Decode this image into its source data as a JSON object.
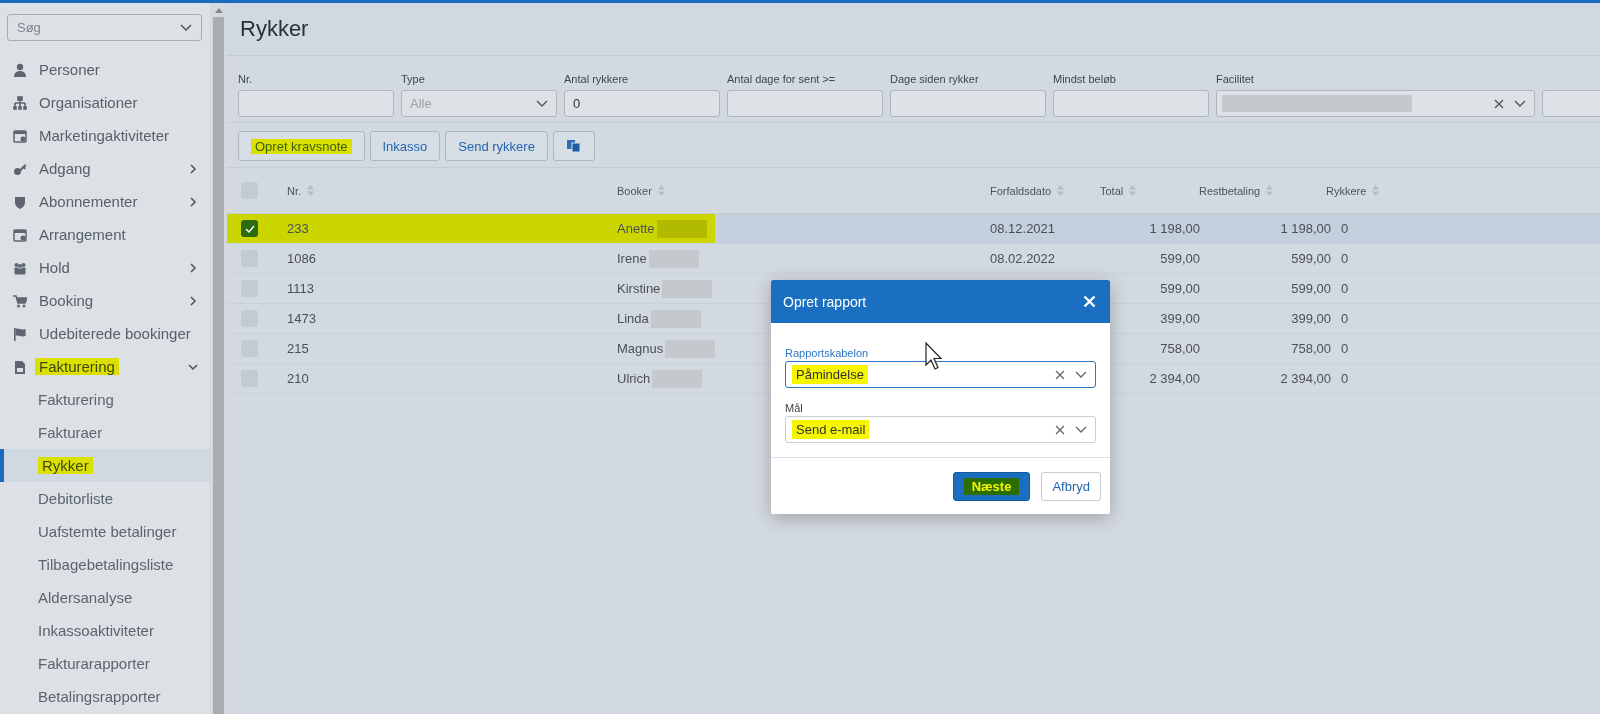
{
  "sidebar": {
    "search": {
      "placeholder": "Søg"
    },
    "items": [
      {
        "kind": "link",
        "label": "Personer"
      },
      {
        "kind": "link",
        "label": "Organisationer"
      },
      {
        "kind": "link",
        "label": "Marketingaktiviteter"
      },
      {
        "kind": "group",
        "label": "Adgang",
        "expanded": false,
        "highlighted": false
      },
      {
        "kind": "group",
        "label": "Abonnementer",
        "expanded": false,
        "highlighted": false
      },
      {
        "kind": "link",
        "label": "Arrangement"
      },
      {
        "kind": "group",
        "label": "Hold",
        "expanded": false,
        "highlighted": false
      },
      {
        "kind": "group",
        "label": "Booking",
        "expanded": false,
        "highlighted": false
      },
      {
        "kind": "link",
        "label": "Udebiterede bookinger"
      },
      {
        "kind": "group",
        "label": "Fakturering",
        "expanded": true,
        "highlighted": true,
        "children": [
          {
            "label": "Fakturering",
            "selected": false,
            "highlighted": false
          },
          {
            "label": "Fakturaer",
            "selected": false,
            "highlighted": false
          },
          {
            "label": "Rykker",
            "selected": true,
            "highlighted": true
          },
          {
            "label": "Debitorliste",
            "selected": false,
            "highlighted": false
          },
          {
            "label": "Uafstemte betalinger",
            "selected": false,
            "highlighted": false
          },
          {
            "label": "Tilbagebetalingsliste",
            "selected": false,
            "highlighted": false
          },
          {
            "label": "Aldersanalyse",
            "selected": false,
            "highlighted": false
          },
          {
            "label": "Inkassoaktiviteter",
            "selected": false,
            "highlighted": false
          },
          {
            "label": "Fakturarapporter",
            "selected": false,
            "highlighted": false
          },
          {
            "label": "Betalingsrapporter",
            "selected": false,
            "highlighted": false
          }
        ]
      }
    ]
  },
  "page": {
    "title": "Rykker"
  },
  "filters": [
    {
      "kind": "text",
      "label": "Nr."
    },
    {
      "kind": "select",
      "label": "Type",
      "placeholder": "Alle"
    },
    {
      "kind": "text",
      "label": "Antal rykkere",
      "value": "0"
    },
    {
      "kind": "text",
      "label": "Antal dage for sent >="
    },
    {
      "kind": "text",
      "label": "Dage siden rykker"
    },
    {
      "kind": "text",
      "label": "Mindst beløb"
    },
    {
      "kind": "combo",
      "label": "Facilitet",
      "redacted": true
    }
  ],
  "toolbar": [
    {
      "kind": "text",
      "label": "Opret kravsnote",
      "highlighted": true
    },
    {
      "kind": "text",
      "label": "Inkasso",
      "highlighted": false
    },
    {
      "kind": "text",
      "label": "Send rykkere",
      "highlighted": false
    },
    {
      "kind": "icon"
    }
  ],
  "table": {
    "all_selected": false,
    "columns": [
      "Nr.",
      "Booker",
      "Forfaldsdato",
      "Total",
      "Restbetaling",
      "Rykkere"
    ],
    "rows": [
      {
        "selected": true,
        "highlighted": true,
        "nr": "233",
        "booker": "Anette",
        "booker_redacted": true,
        "due": "08.12.2021",
        "total": "1 198,00",
        "rest": "1 198,00",
        "reminders": "0"
      },
      {
        "selected": false,
        "highlighted": false,
        "nr": "1086",
        "booker": "Irene",
        "booker_redacted": true,
        "due": "08.02.2022",
        "total": "599,00",
        "rest": "599,00",
        "reminders": "0"
      },
      {
        "selected": false,
        "highlighted": false,
        "nr": "1113",
        "booker": "Kirstine",
        "booker_redacted": true,
        "total": "599,00",
        "rest": "599,00",
        "reminders": "0"
      },
      {
        "selected": false,
        "highlighted": false,
        "nr": "1473",
        "booker": "Linda",
        "booker_redacted": true,
        "total": "399,00",
        "rest": "399,00",
        "reminders": "0"
      },
      {
        "selected": false,
        "highlighted": false,
        "nr": "215",
        "booker": "Magnus",
        "booker_redacted": true,
        "total": "758,00",
        "rest": "758,00",
        "reminders": "0"
      },
      {
        "selected": false,
        "highlighted": false,
        "nr": "210",
        "booker": "Ulrich",
        "booker_redacted": true,
        "total": "2 394,00",
        "rest": "2 394,00",
        "reminders": "0"
      }
    ]
  },
  "dialog": {
    "title": "Opret rapport",
    "fields": [
      {
        "label": "Rapportskabelon",
        "value": "Påmindelse",
        "focused": true,
        "highlighted": true
      },
      {
        "label": "Mål",
        "value": "Send e-mail",
        "focused": false,
        "highlighted": true
      }
    ],
    "buttons": [
      {
        "kind": "primary",
        "label": "Næste",
        "highlighted": true
      },
      {
        "kind": "secondary",
        "label": "Afbryd",
        "highlighted": false
      }
    ]
  }
}
